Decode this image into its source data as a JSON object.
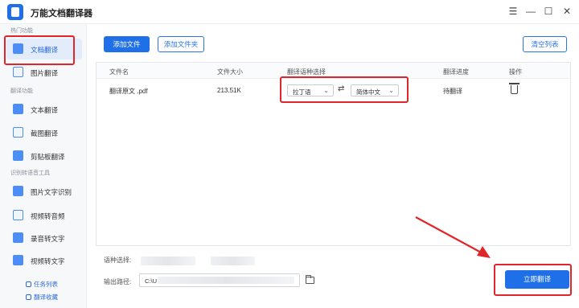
{
  "app": {
    "title": "万能文档翻译器"
  },
  "window_controls": {
    "menu": "☰",
    "minimize": "—",
    "maximize": "☐",
    "close": "✕"
  },
  "sidebar": {
    "sections": [
      {
        "title": "热门功能",
        "items": [
          {
            "label": "文档翻译",
            "icon": "document-translate-icon",
            "active": true
          },
          {
            "label": "图片翻译",
            "icon": "image-translate-icon"
          }
        ]
      },
      {
        "title": "翻译功能",
        "items": [
          {
            "label": "文本翻译",
            "icon": "text-translate-icon"
          },
          {
            "label": "截图翻译",
            "icon": "screenshot-translate-icon"
          },
          {
            "label": "剪贴板翻译",
            "icon": "clipboard-translate-icon"
          }
        ]
      },
      {
        "title": "识别转语音工具",
        "items": [
          {
            "label": "图片文字识别",
            "icon": "ocr-icon"
          },
          {
            "label": "视频转音频",
            "icon": "video-to-audio-icon"
          },
          {
            "label": "录音转文字",
            "icon": "record-to-text-icon"
          },
          {
            "label": "视频转文字",
            "icon": "video-to-text-icon"
          }
        ]
      }
    ],
    "bottom_links": [
      "任务列表",
      "翻译收藏"
    ]
  },
  "toolbar": {
    "add_file": "添加文件",
    "add_folder": "添加文件夹",
    "clear_list": "清空列表"
  },
  "table": {
    "headers": [
      "文件名",
      "文件大小",
      "翻译语种选择",
      "翻译进度",
      "操作"
    ],
    "rows": [
      {
        "filename": "翻译原文 .pdf",
        "size": "213.51K",
        "source_lang": "拉丁语",
        "target_lang": "简体中文",
        "progress": "待翻译"
      }
    ]
  },
  "footer": {
    "lang_label": "语种选择:",
    "output_label": "输出路径:",
    "output_path_prefix": "C:\\U",
    "translate_button": "立即翻译"
  },
  "colors": {
    "accent": "#1f6fe8",
    "highlight": "#e0262a"
  }
}
